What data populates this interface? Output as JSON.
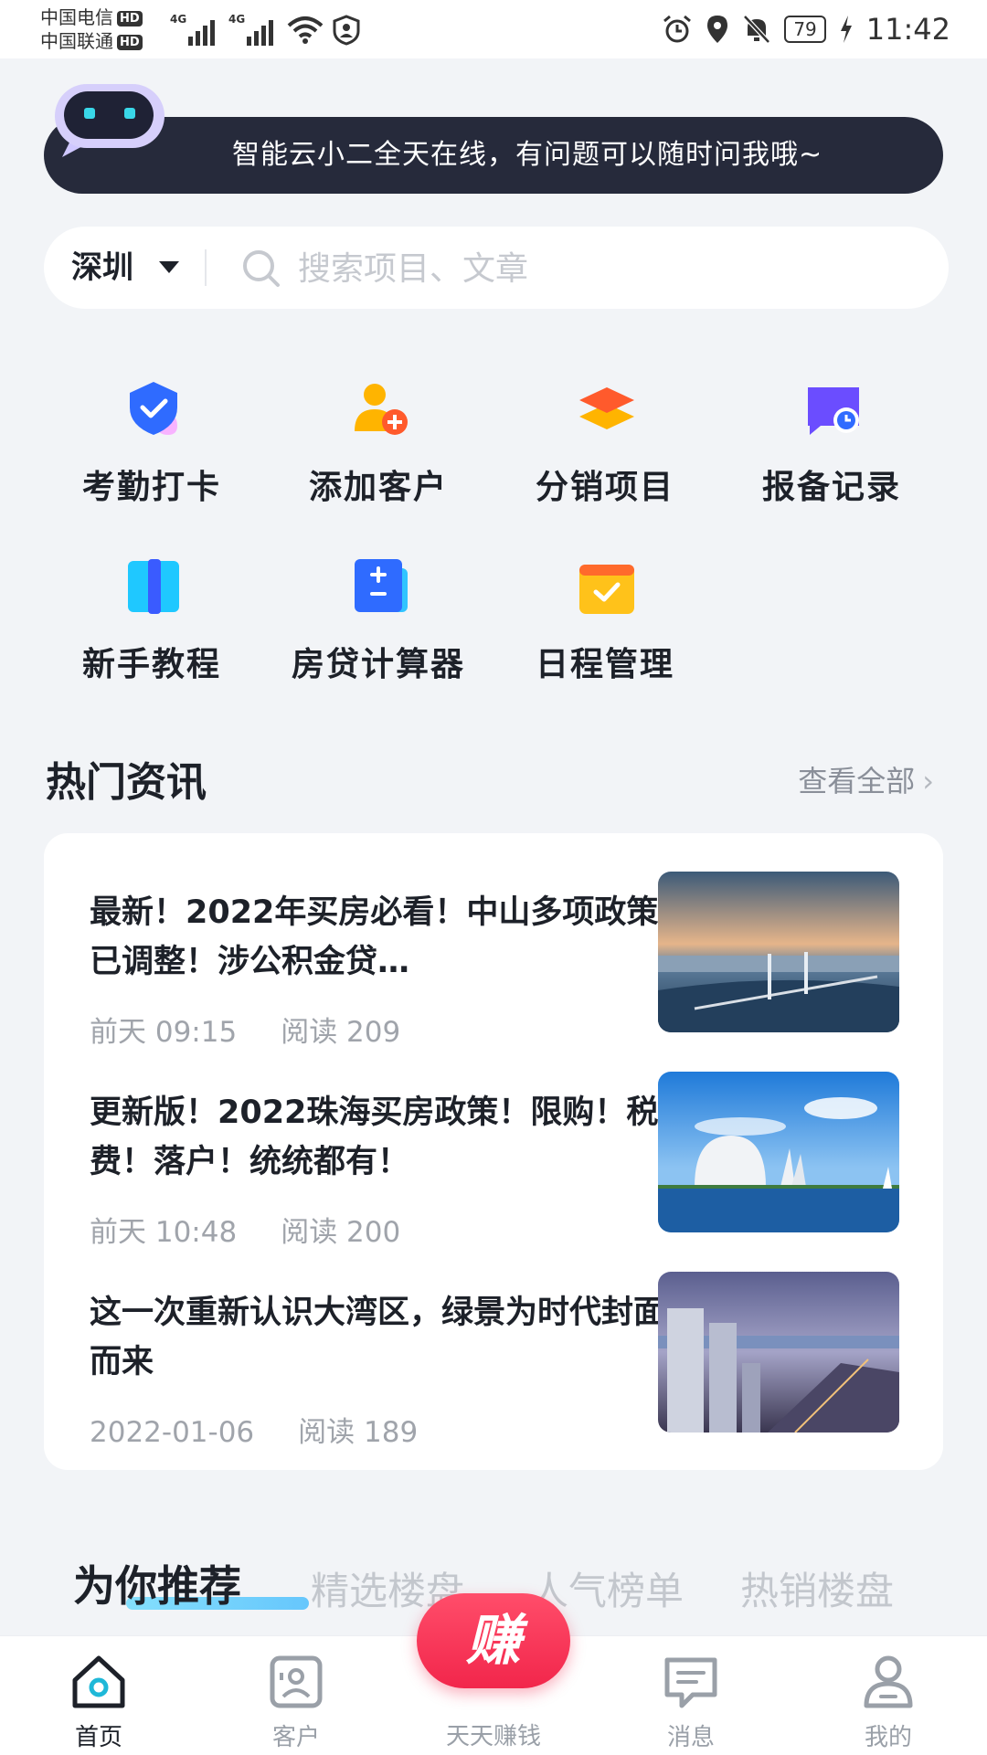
{
  "status_bar": {
    "carrier1": "中国电信",
    "carrier2": "中国联通",
    "hd": "HD",
    "network": "4G",
    "battery": "79",
    "time": "11:42"
  },
  "assistant": {
    "message": "智能云小二全天在线，有问题可以随时问我哦~"
  },
  "search": {
    "city": "深圳",
    "placeholder": "搜索项目、文章"
  },
  "shortcuts": [
    {
      "label": "考勤打卡",
      "icon": "check-badge-icon",
      "color": "#2f6bff"
    },
    {
      "label": "添加客户",
      "icon": "add-user-icon",
      "color": "#ffb400"
    },
    {
      "label": "分销项目",
      "icon": "layers-icon",
      "color": "#ff6a2c"
    },
    {
      "label": "报备记录",
      "icon": "record-clock-icon",
      "color": "#6b4dff"
    },
    {
      "label": "新手教程",
      "icon": "book-icon",
      "color": "#1fc8ff"
    },
    {
      "label": "房贷计算器",
      "icon": "calculator-icon",
      "color": "#2f6bff"
    },
    {
      "label": "日程管理",
      "icon": "calendar-check-icon",
      "color": "#ffb400"
    }
  ],
  "hot_news": {
    "title": "热门资讯",
    "view_all": "查看全部",
    "items": [
      {
        "title": "最新！2022年买房必看！中山多项政策已调整！涉公积金贷…",
        "time": "前天 09:15",
        "reads": "阅读 209"
      },
      {
        "title": "更新版！2022珠海买房政策！限购！税费！落户！统统都有！",
        "time": "前天 10:48",
        "reads": "阅读 200"
      },
      {
        "title": "这一次重新认识大湾区，绿景为时代封面而来",
        "time": "2022-01-06",
        "reads": "阅读 189"
      }
    ]
  },
  "recommend": {
    "title": "为你推荐",
    "tabs": [
      "精选楼盘",
      "人气榜单",
      "热销楼盘"
    ]
  },
  "bottom_nav": {
    "items": [
      "首页",
      "客户",
      "天天赚钱",
      "消息",
      "我的"
    ],
    "earn_glyph": "赚"
  }
}
